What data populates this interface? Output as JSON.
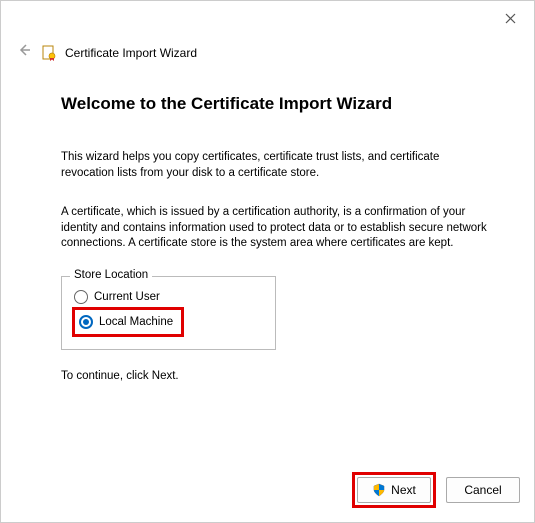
{
  "window": {
    "title": "Certificate Import Wizard"
  },
  "main": {
    "heading": "Welcome to the Certificate Import Wizard",
    "intro": "This wizard helps you copy certificates, certificate trust lists, and certificate revocation lists from your disk to a certificate store.",
    "description": "A certificate, which is issued by a certification authority, is a confirmation of your identity and contains information used to protect data or to establish secure network connections. A certificate store is the system area where certificates are kept.",
    "store_location": {
      "legend": "Store Location",
      "options": {
        "current_user": "Current User",
        "local_machine": "Local Machine"
      },
      "selected": "local_machine"
    },
    "continue_hint": "To continue, click Next."
  },
  "buttons": {
    "next": "Next",
    "cancel": "Cancel"
  },
  "icons": {
    "close": "close-icon",
    "back": "back-arrow-icon",
    "certificate": "certificate-icon",
    "shield": "uac-shield-icon"
  }
}
